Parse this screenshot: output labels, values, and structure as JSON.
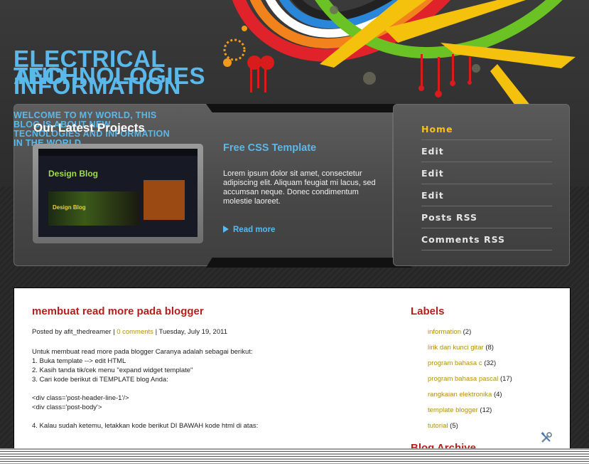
{
  "header": {
    "title_lines": [
      "ELECTRICAL",
      "TECHNOLOGIES",
      "AND",
      "INFORMATION"
    ],
    "description": "WELCOME TO MY WORLD, THIS BLOG IS ABOUT NEW TECNOLOGIES AND INFORMATION IN THE WORLD"
  },
  "featured": {
    "section_title": "Our Latest Projects",
    "thumbnail": {
      "logo_text": "Design Blog",
      "band_text": "Design Blog"
    },
    "title": "Free CSS Template",
    "text": "Lorem ipsum dolor sit amet, consectetur adipiscing elit. Aliquam feugiat mi lacus, sed accumsan neque. Donec condimentum molestie laoreet.",
    "read_more": "Read more"
  },
  "menu": {
    "items": [
      {
        "label": "Home",
        "active": true
      },
      {
        "label": "Edit"
      },
      {
        "label": "Edit"
      },
      {
        "label": "Edit"
      },
      {
        "label": "Posts RSS"
      },
      {
        "label": "Comments RSS"
      }
    ]
  },
  "post": {
    "title": "membuat read more pada blogger",
    "meta_prefix": "Posted by afit_thedreamer | ",
    "comments": "0 comments",
    "meta_suffix": " | Tuesday, July 19, 2011",
    "body": [
      "Untuk membuat read more pada blogger Caranya adalah sebagai berikut:",
      "1. Buka template --> edit HTML",
      "2. Kasih tanda tik/cek menu \"expand widget template\"",
      "3. Cari kode berikut di TEMPLATE blog Anda:",
      "",
      "<div class='post-header-line-1'/>",
      "<div class='post-body'>",
      "",
      "4. Kalau sudah ketemu, letakkan kode berikut DI BAWAH kode html di atas:"
    ]
  },
  "sidebar": {
    "labels_title": "Labels",
    "labels": [
      {
        "name": "information",
        "count": "(2)"
      },
      {
        "name": "lirik dan kunci gitar",
        "count": "(8)"
      },
      {
        "name": "program bahasa c",
        "count": "(32)"
      },
      {
        "name": "program bahasa pascal",
        "count": "(17)"
      },
      {
        "name": "rangkaian elektronika",
        "count": "(4)"
      },
      {
        "name": "template blogger",
        "count": "(12)"
      },
      {
        "name": "tutorial",
        "count": "(5)"
      }
    ],
    "archive_title": "Blog Archive"
  },
  "colors": {
    "accent_blue": "#5ab8ea",
    "active_menu": "#f3c31a",
    "heading_red": "#b61e1e",
    "link_gold": "#b48f14"
  }
}
